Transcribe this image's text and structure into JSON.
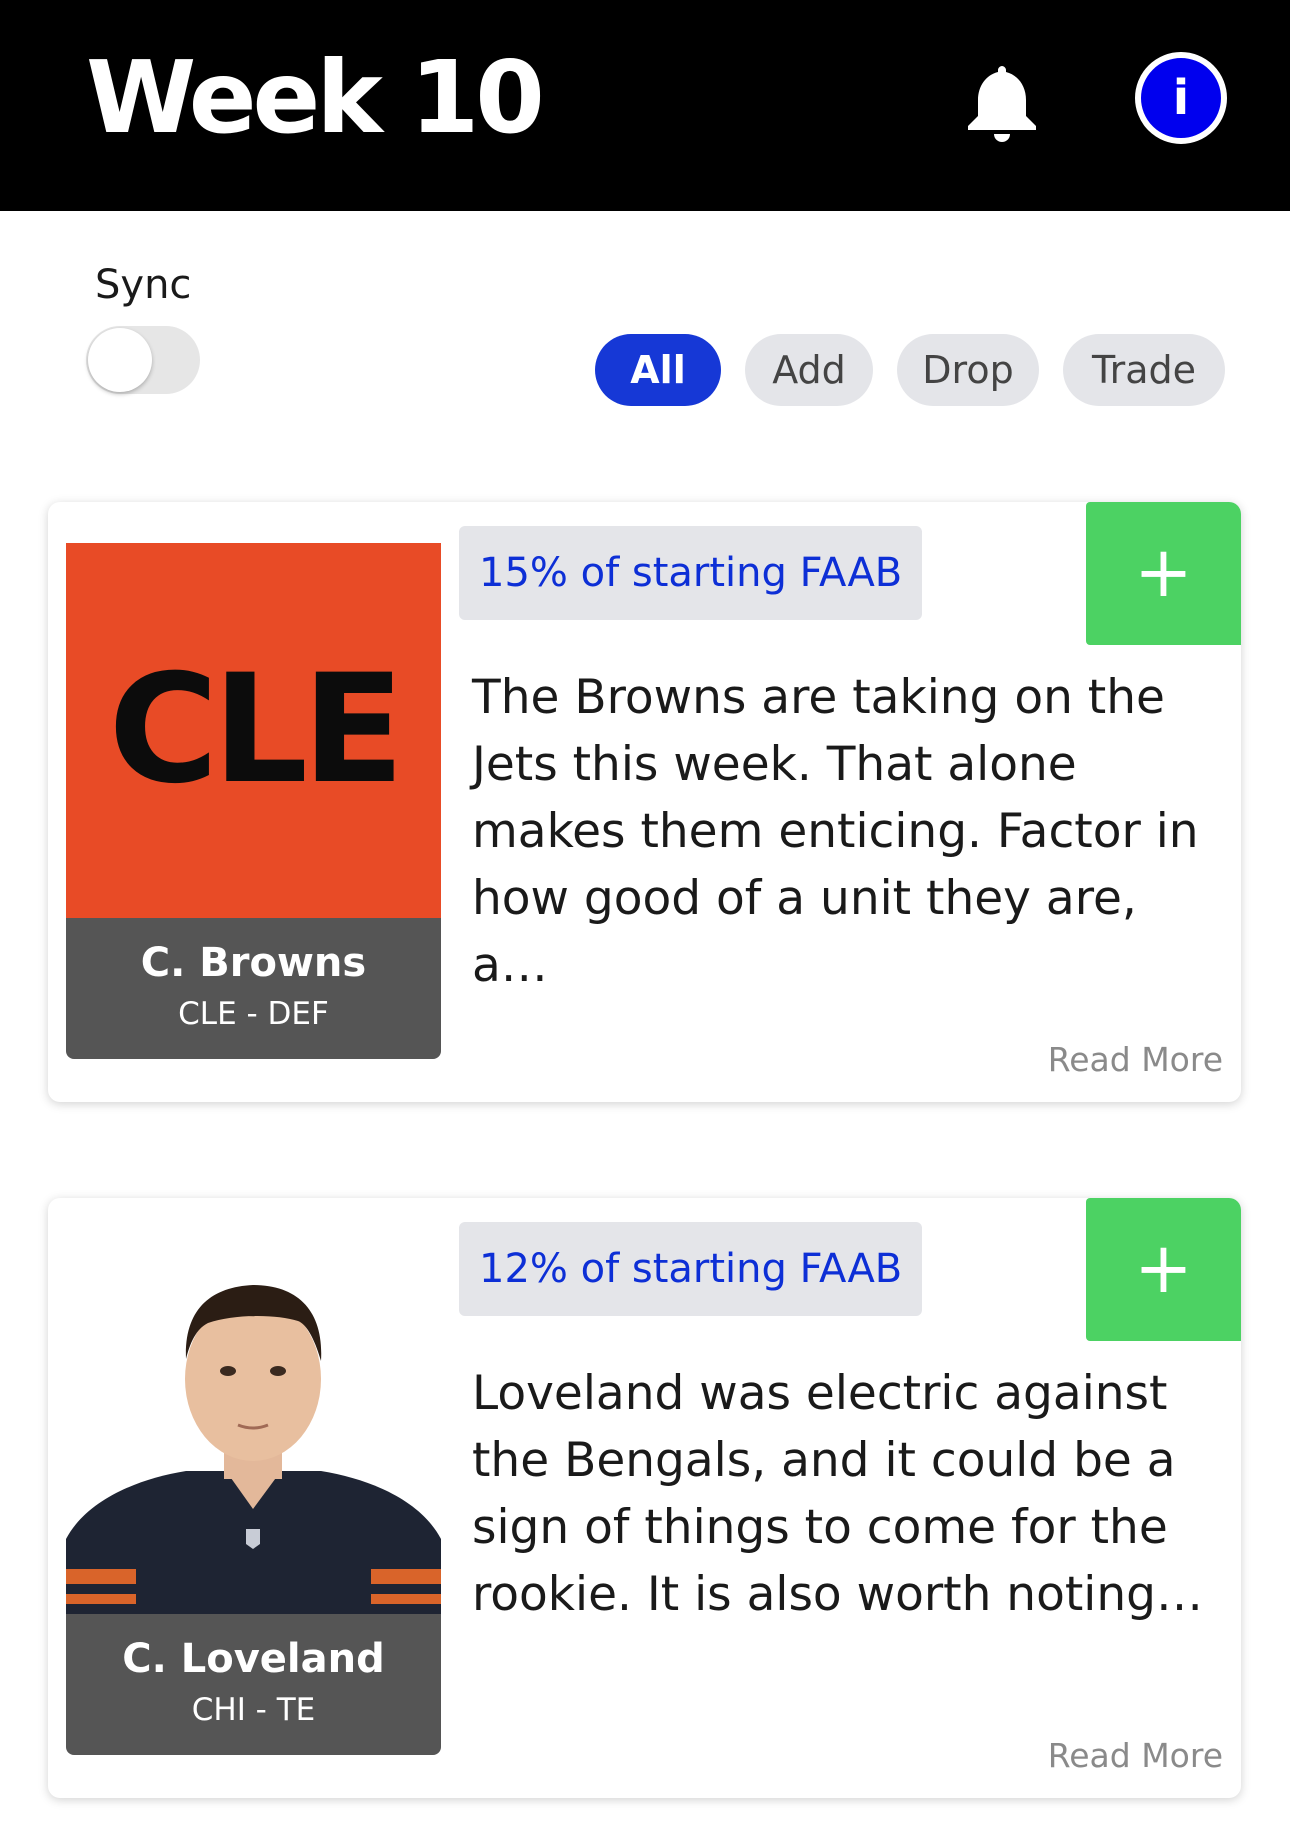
{
  "header": {
    "title": "Week 10",
    "icons": [
      "bell-icon",
      "info-icon"
    ]
  },
  "sync": {
    "label": "Sync",
    "enabled": false
  },
  "filters": [
    {
      "label": "All",
      "active": true
    },
    {
      "label": "Add",
      "active": false
    },
    {
      "label": "Drop",
      "active": false
    },
    {
      "label": "Trade",
      "active": false
    }
  ],
  "cards": [
    {
      "logo_text": "CLE",
      "name": "C. Browns",
      "position": "CLE - DEF",
      "faab": "15% of starting FAAB",
      "description": "The Browns are taking on the Jets this week. That alone makes them enticing. Factor in how good of a unit they are, a…",
      "read_more": "Read More",
      "colors": {
        "logo_bg": "#e84b26"
      }
    },
    {
      "name": "C. Loveland",
      "position": "CHI - TE",
      "faab": "12% of starting FAAB",
      "description": "Loveland was electric against the Bengals, and it could be a sign of things to come for the rookie. It is also worth noting…",
      "read_more": "Read More"
    }
  ],
  "colors": {
    "accent": "#1638d6",
    "add_button": "#4cd263",
    "faab_text": "#0d2fd6",
    "header_bg": "#000000"
  }
}
